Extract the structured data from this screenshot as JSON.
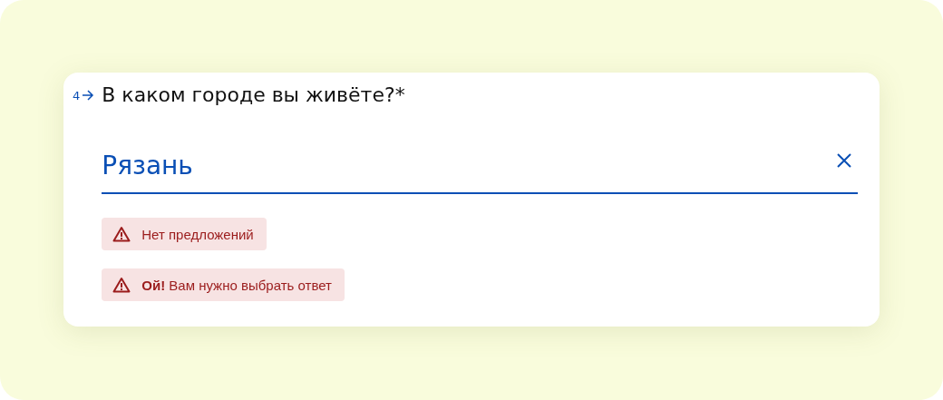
{
  "question": {
    "number": "4",
    "text": "В каком городе вы живёте?*"
  },
  "answer": {
    "value": "Рязань"
  },
  "alerts": [
    {
      "text": "Нет предложений"
    },
    {
      "text": "**Ой!** Вам нужно выбрать ответ"
    }
  ]
}
